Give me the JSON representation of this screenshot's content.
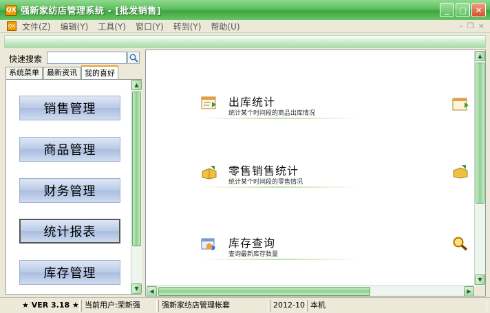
{
  "window": {
    "title": "强新家纺店管理系统 - [批发销售]",
    "app_icon_text": "QX",
    "minimize_label": "_",
    "maximize_label": "□",
    "close_label": "✕"
  },
  "menu": {
    "items": [
      "文件(Z)",
      "编辑(Y)",
      "工具(Y)",
      "窗口(Y)",
      "转到(Y)",
      "帮助(U)"
    ],
    "mdi_buttons": [
      "–",
      "❐",
      "×"
    ]
  },
  "left_panel": {
    "search_label": "快速搜索",
    "search_value": "",
    "tabs": [
      "系统菜单",
      "最新资讯",
      "我的喜好"
    ],
    "active_tab": "我的喜好",
    "buttons": [
      "销售管理",
      "商品管理",
      "财务管理",
      "统计报表",
      "库存管理"
    ],
    "selected_button": "统计报表"
  },
  "content": {
    "features": [
      {
        "title": "出库统计",
        "desc": "统计某个时间段的商品出库情况",
        "icon": "outbound-stats-icon"
      },
      {
        "title": "零售销售统计",
        "desc": "统计某个时间段的零售情况",
        "icon": "retail-stats-icon"
      },
      {
        "title": "库存查询",
        "desc": "查询最新库存数量",
        "icon": "inventory-query-icon"
      }
    ]
  },
  "statusbar": {
    "version": "★ VER 3.18 ★",
    "current_user": "当前用户:荣新强",
    "account": "强新家纺店管理帐套",
    "date": "2012-10",
    "machine": "本机"
  },
  "colors": {
    "title_green": "#5cbf5c",
    "button_blue": "#b8c9e6",
    "scrollbar_green": "#8fcf8f"
  }
}
